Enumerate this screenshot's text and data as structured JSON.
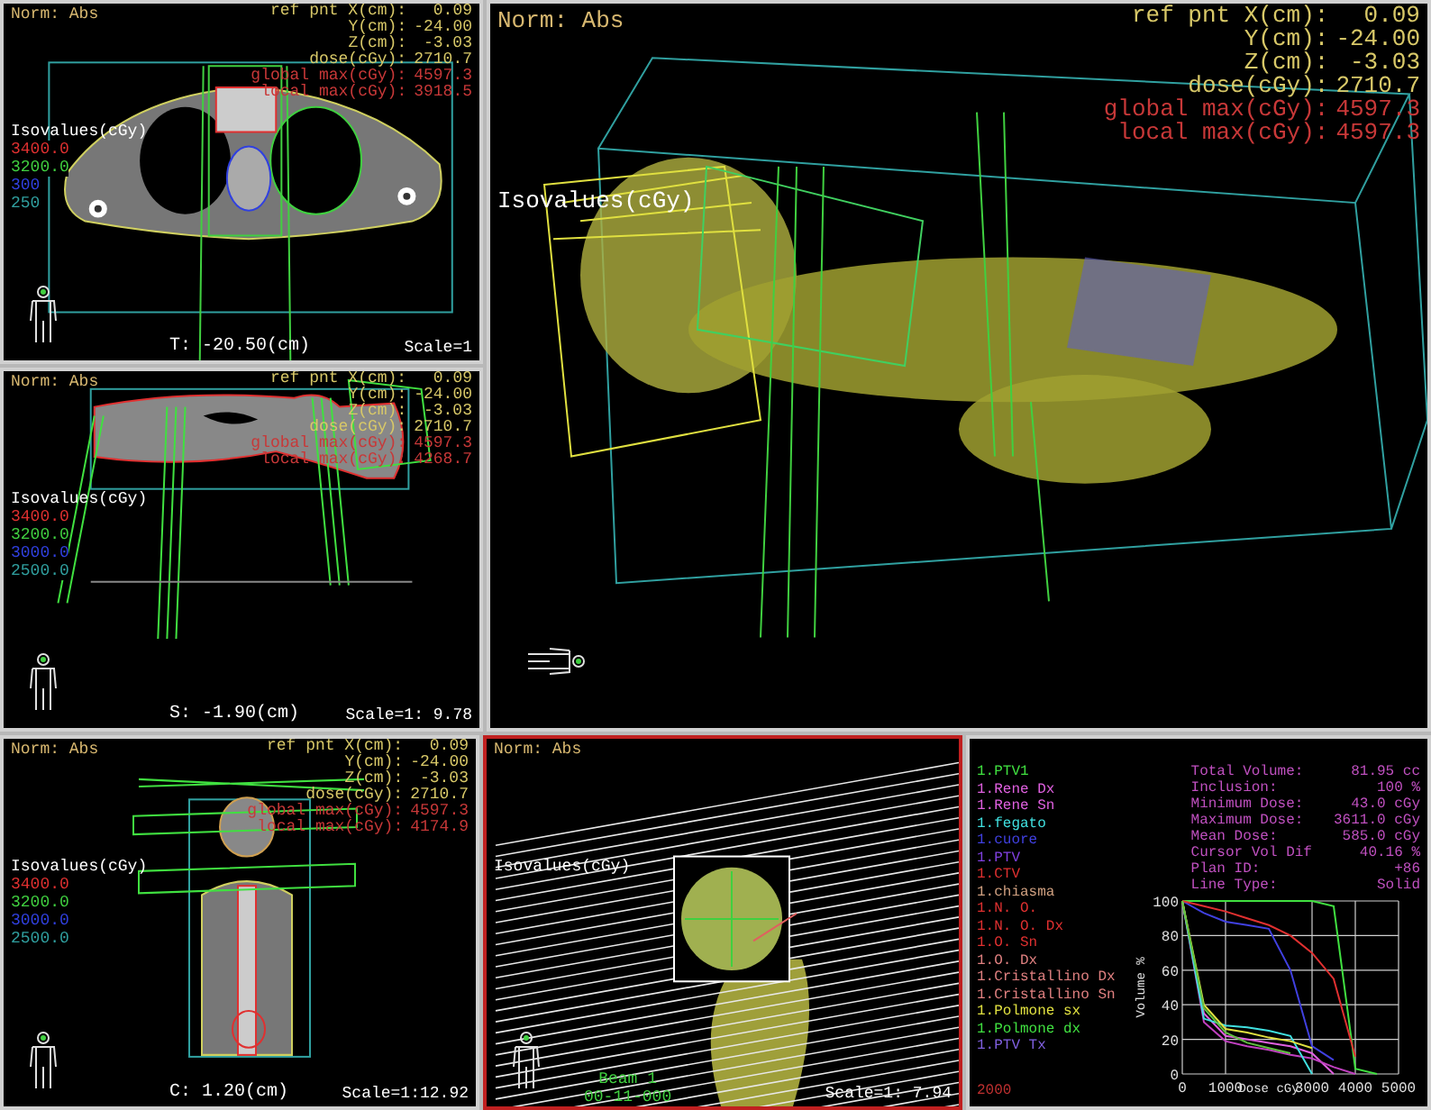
{
  "left_column": [
    {
      "kind": "axial",
      "selected": false,
      "norm": "Norm: Abs",
      "ref_point": [
        {
          "label": "ref pnt X(cm):",
          "value": "0.09",
          "kind": "coord"
        },
        {
          "label": "Y(cm):",
          "value": "-24.00",
          "kind": "coord"
        },
        {
          "label": "Z(cm):",
          "value": "-3.03",
          "kind": "coord"
        },
        {
          "label": "dose(cGy):",
          "value": "2710.7",
          "kind": "coord"
        },
        {
          "label": "global max(cGy):",
          "value": "4597.3",
          "kind": "max"
        },
        {
          "label": "local max(cGy):",
          "value": "3918.5",
          "kind": "max"
        }
      ],
      "isovalues": {
        "title": "Isovalues(cGy)",
        "levels": [
          {
            "value": "3400.0",
            "color": "#e03030"
          },
          {
            "value": "3200.0",
            "color": "#40d040"
          },
          {
            "value": "300",
            "color": "#3040e0"
          },
          {
            "value": "250",
            "color": "#30a0a0"
          }
        ]
      },
      "slice": "T: -20.50(cm)",
      "scale": "Scale=1"
    },
    {
      "kind": "sagittal",
      "selected": false,
      "norm": "Norm: Abs",
      "ref_point": [
        {
          "label": "ref pnt X(cm):",
          "value": "0.09",
          "kind": "coord"
        },
        {
          "label": "Y(cm):",
          "value": "-24.00",
          "kind": "coord"
        },
        {
          "label": "Z(cm):",
          "value": "-3.03",
          "kind": "coord"
        },
        {
          "label": "dose(cGy):",
          "value": "2710.7",
          "kind": "coord"
        },
        {
          "label": "global max(cGy):",
          "value": "4597.3",
          "kind": "max"
        },
        {
          "label": "local max(cGy):",
          "value": "4268.7",
          "kind": "max"
        }
      ],
      "isovalues": {
        "title": "Isovalues(cGy)",
        "levels": [
          {
            "value": "3400.0",
            "color": "#e03030"
          },
          {
            "value": "3200.0",
            "color": "#40d040"
          },
          {
            "value": "3000.0",
            "color": "#3040e0"
          },
          {
            "value": "2500.0",
            "color": "#30a0a0"
          }
        ]
      },
      "slice": "S: -1.90(cm)",
      "scale": "Scale=1: 9.78"
    }
  ],
  "main_view": {
    "kind": "render3d",
    "selected": false,
    "norm": "Norm: Abs",
    "ref_point": [
      {
        "label": "ref pnt X(cm):",
        "value": "0.09",
        "kind": "coord"
      },
      {
        "label": "Y(cm):",
        "value": "-24.00",
        "kind": "coord"
      },
      {
        "label": "Z(cm):",
        "value": "-3.03",
        "kind": "coord"
      },
      {
        "label": "dose(cGy):",
        "value": "2710.7",
        "kind": "coord"
      },
      {
        "label": "global max(cGy):",
        "value": "4597.3",
        "kind": "max"
      },
      {
        "label": "local max(cGy):",
        "value": "4597.3",
        "kind": "max"
      }
    ],
    "isovalues": {
      "title": "Isovalues(cGy)"
    }
  },
  "bottom_row": [
    {
      "kind": "coronal",
      "selected": false,
      "norm": "Norm: Abs",
      "ref_point": [
        {
          "label": "ref pnt X(cm):",
          "value": "0.09",
          "kind": "coord"
        },
        {
          "label": "Y(cm):",
          "value": "-24.00",
          "kind": "coord"
        },
        {
          "label": "Z(cm):",
          "value": "-3.03",
          "kind": "coord"
        },
        {
          "label": "dose(cGy):",
          "value": "2710.7",
          "kind": "coord"
        },
        {
          "label": "global max(cGy):",
          "value": "4597.3",
          "kind": "max"
        },
        {
          "label": "local max(cGy):",
          "value": "4174.9",
          "kind": "max"
        }
      ],
      "isovalues": {
        "title": "Isovalues(cGy)",
        "levels": [
          {
            "value": "3400.0",
            "color": "#e03030"
          },
          {
            "value": "3200.0",
            "color": "#40d040"
          },
          {
            "value": "3000.0",
            "color": "#3040e0"
          },
          {
            "value": "2500.0",
            "color": "#30a0a0"
          }
        ]
      },
      "slice": "C: 1.20(cm)",
      "scale": "Scale=1:12.92"
    },
    {
      "kind": "beams_eye",
      "selected": true,
      "norm": "Norm: Abs",
      "isovalues": {
        "title": "Isovalues(cGy)"
      },
      "beam": "Beam 1",
      "beam_code": "00-11-000",
      "scale": "Scale=1: 7.94"
    },
    {
      "kind": "dvh",
      "selected": false,
      "stats": [
        {
          "label": "Total Volume:",
          "value": "81.95 cc"
        },
        {
          "label": "Inclusion:",
          "value": "100 %"
        },
        {
          "label": "Minimum Dose:",
          "value": "43.0 cGy"
        },
        {
          "label": "Maximum Dose:",
          "value": "3611.0 cGy"
        },
        {
          "label": "Mean Dose:",
          "value": "585.0 cGy"
        },
        {
          "label": "Cursor Vol Dif",
          "value": "40.16 %"
        },
        {
          "label": "Plan ID:",
          "value": "+86"
        },
        {
          "label": "Line Type:",
          "value": "Solid"
        }
      ],
      "structures": [
        {
          "label": "1.PTV1",
          "color": "#40e040"
        },
        {
          "label": "1.Rene Dx",
          "color": "#e060e0"
        },
        {
          "label": "1.Rene Sn",
          "color": "#e060e0"
        },
        {
          "label": "1.fegato",
          "color": "#40e0e0"
        },
        {
          "label": "1.cuore",
          "color": "#4040e0"
        },
        {
          "label": "1.PTV",
          "color": "#8040e0"
        },
        {
          "label": "1.CTV",
          "color": "#e03030"
        },
        {
          "label": "1.chiasma",
          "color": "#d0a080"
        },
        {
          "label": "1.N. O.",
          "color": "#e03030"
        },
        {
          "label": "1.N. O. Dx",
          "color": "#e03030"
        },
        {
          "label": "1.O. Sn",
          "color": "#e03030"
        },
        {
          "label": "1.O. Dx",
          "color": "#e08080"
        },
        {
          "label": "1.Cristallino Dx",
          "color": "#e08080"
        },
        {
          "label": "1.Cristallino Sn",
          "color": "#e08080"
        },
        {
          "label": "1.Polmone sx",
          "color": "#e0e040"
        },
        {
          "label": "1.Polmone dx",
          "color": "#40e040"
        },
        {
          "label": "1.PTV Tx",
          "color": "#8060e0"
        }
      ],
      "dose_cursor": "2000",
      "chart_data": {
        "type": "line",
        "xlabel": "Dose cGy",
        "ylabel": "Volume %",
        "grid": true,
        "x": [
          0,
          500,
          1000,
          1500,
          2000,
          2500,
          3000,
          3500,
          4000,
          4500
        ],
        "xlim": [
          0,
          5000
        ],
        "ylim": [
          0,
          100
        ],
        "xticks": [
          0,
          1000,
          3000,
          4000,
          5000
        ],
        "yticks": [
          0,
          20,
          40,
          60,
          80,
          100
        ],
        "series": [
          {
            "color": "#40e040",
            "values": [
              100,
              100,
              100,
              100,
              100,
              100,
              100,
              97,
              3,
              0
            ]
          },
          {
            "color": "#e060e0",
            "values": [
              100,
              35,
              22,
              20,
              18,
              16,
              12,
              0,
              null,
              null
            ]
          },
          {
            "color": "#c040c0",
            "values": [
              100,
              30,
              19,
              16,
              14,
              11,
              9,
              4,
              0,
              null
            ]
          },
          {
            "color": "#40e0e0",
            "values": [
              100,
              32,
              28,
              27,
              25,
              22,
              0,
              null,
              null,
              null
            ]
          },
          {
            "color": "#4040e0",
            "values": [
              100,
              93,
              88,
              86,
              84,
              60,
              16,
              8,
              null,
              null
            ]
          },
          {
            "color": "#e03030",
            "values": [
              100,
              97,
              94,
              90,
              86,
              80,
              70,
              55,
              10,
              null
            ]
          },
          {
            "color": "#e0e040",
            "values": [
              100,
              40,
              26,
              24,
              21,
              19,
              15,
              null,
              null,
              null
            ]
          },
          {
            "color": "#60c040",
            "values": [
              100,
              38,
              24,
              18,
              15,
              12,
              null,
              null,
              null,
              null
            ]
          }
        ]
      }
    }
  ]
}
